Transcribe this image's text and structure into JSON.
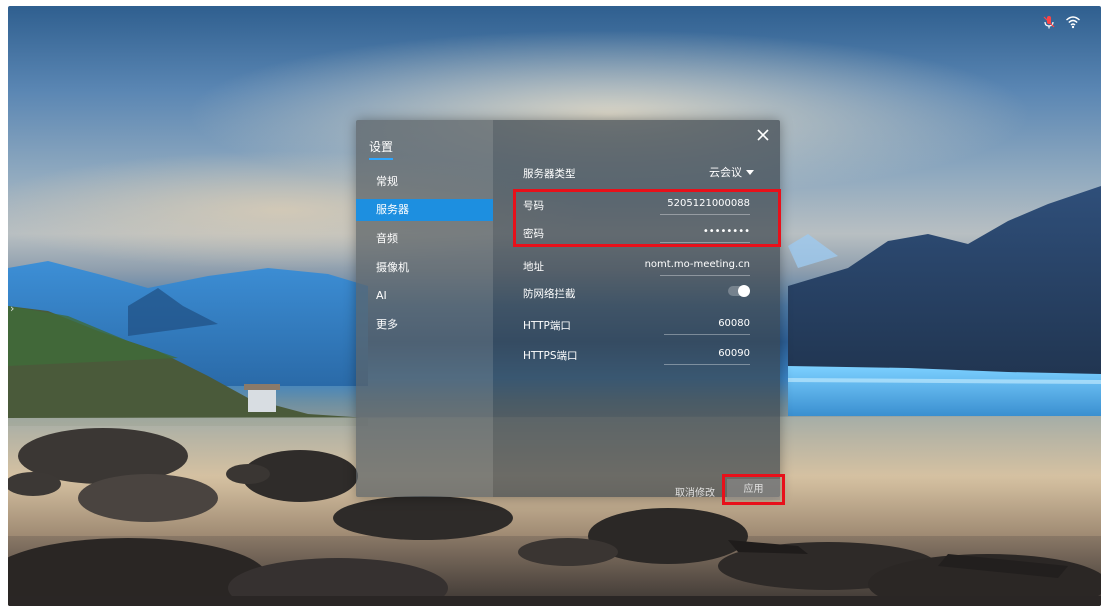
{
  "status_bar": {
    "icons": [
      "microphone-icon",
      "wifi-icon"
    ],
    "mic_color": "#ff4444"
  },
  "settings": {
    "title": "设置",
    "nav": [
      {
        "label": "常规",
        "active": false
      },
      {
        "label": "服务器",
        "active": true
      },
      {
        "label": "音频",
        "active": false
      },
      {
        "label": "摄像机",
        "active": false
      },
      {
        "label": "AI",
        "active": false
      },
      {
        "label": "更多",
        "active": false
      }
    ],
    "accent_color": "#1d8fe0"
  },
  "server": {
    "type_label": "服务器类型",
    "type_value": "云会议",
    "account_label": "号码",
    "account_value": "5205121000088",
    "password_label": "密码",
    "password_value": "••••••••",
    "address_label": "地址",
    "address_value": "nomt.mo-meeting.cn",
    "firewall_label": "防网络拦截",
    "firewall_on": true,
    "http_port_label": "HTTP端口",
    "http_port_value": "60080",
    "https_port_label": "HTTPS端口",
    "https_port_value": "60090"
  },
  "actions": {
    "cancel_label": "取消修改",
    "apply_label": "应用"
  },
  "annotation_color": "#e8101a"
}
